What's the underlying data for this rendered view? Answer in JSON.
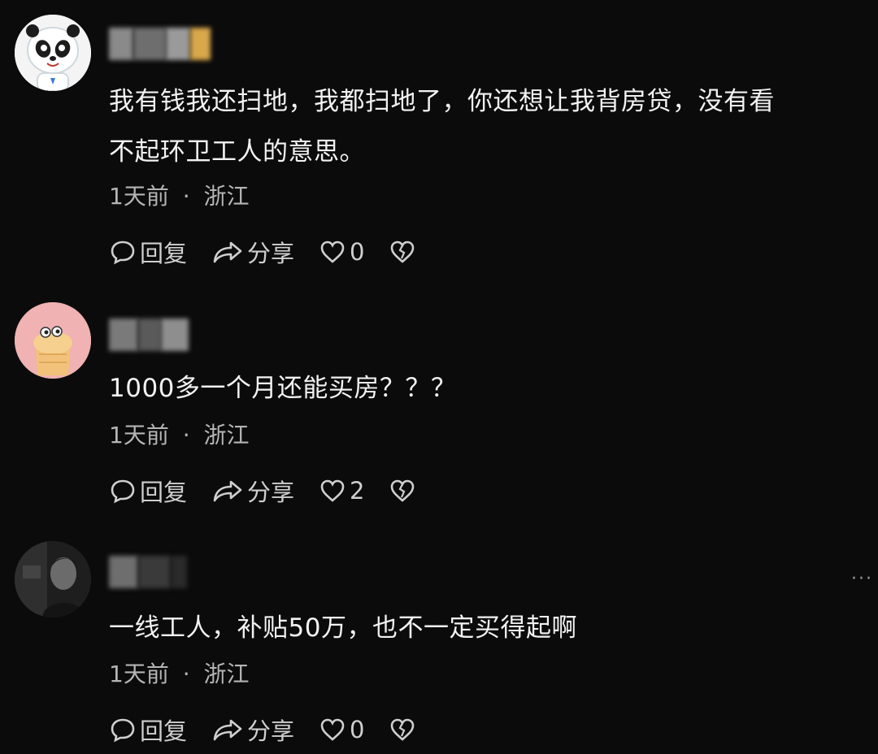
{
  "comments": [
    {
      "text_lines": [
        "我有钱我还扫地，我都扫地了，你还想让我背房贷，没有看",
        "不起环卫工人的意思。"
      ],
      "time": "1天前",
      "separator": "·",
      "location": "浙江",
      "reply_label": "回复",
      "share_label": "分享",
      "like_count": "0",
      "avatar_icon": "panda-mascot-icon"
    },
    {
      "text_lines": [
        "1000多一个月还能买房？？？"
      ],
      "time": "1天前",
      "separator": "·",
      "location": "浙江",
      "reply_label": "回复",
      "share_label": "分享",
      "like_count": "2",
      "avatar_icon": "cartoon-bun-icon"
    },
    {
      "text_lines": [
        "一线工人，补贴50万，也不一定买得起啊"
      ],
      "time": "1天前",
      "separator": "·",
      "location": "浙江",
      "reply_label": "回复",
      "share_label": "分享",
      "like_count": "0",
      "avatar_icon": "photo-portrait-icon",
      "more_label": "···"
    }
  ],
  "colors": {
    "background": "#0b0b0b",
    "text": "#f2f2f2",
    "meta": "#b5b5b5",
    "action": "#cfcfcf"
  }
}
